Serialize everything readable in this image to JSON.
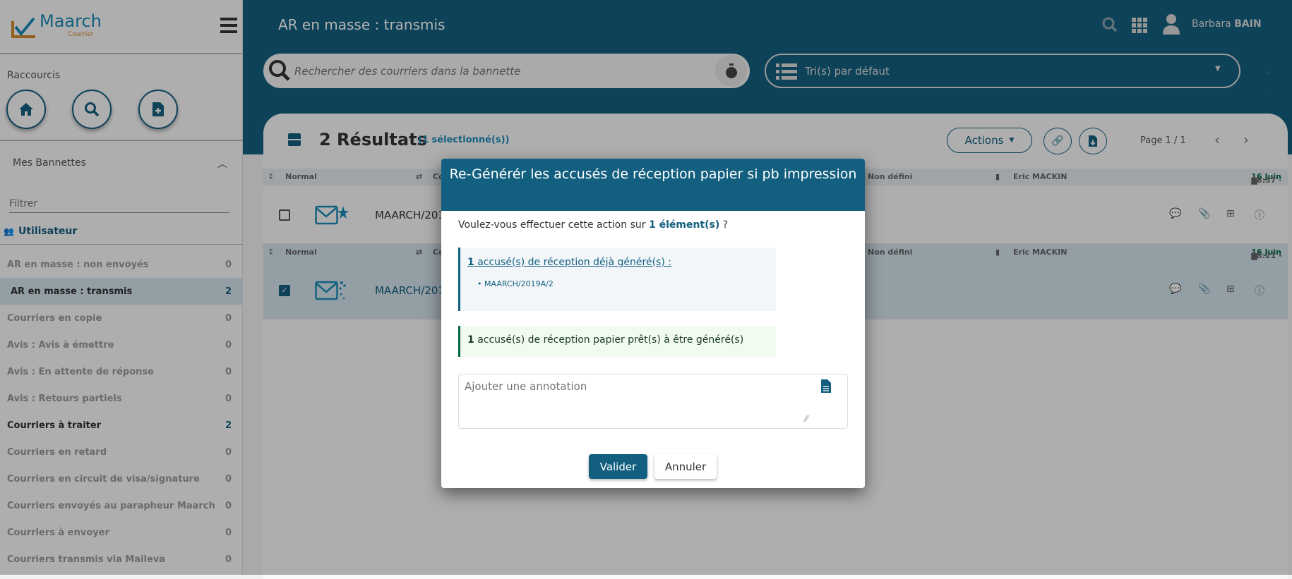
{
  "app": {
    "logo_text": "Maarch",
    "logo_sub": "Courrier",
    "page_title": "AR en masse : transmis"
  },
  "header": {
    "user_first": "Barbara",
    "user_last": "BAIN"
  },
  "search": {
    "placeholder": "Rechercher des courriers dans la bannette"
  },
  "sort": {
    "selected": "Tri(s) par défaut"
  },
  "sidebar": {
    "shortcuts_title": "Raccourcis",
    "bannettes_title": "Mes Bannettes",
    "filter_placeholder": "Filtrer",
    "group": "Utilisateur",
    "items": [
      {
        "label": "AR en masse : non envoyés",
        "count": "0"
      },
      {
        "label": "AR en masse : transmis",
        "count": "2"
      },
      {
        "label": "Courriers en copie",
        "count": "0"
      },
      {
        "label": "Avis : Avis à émettre",
        "count": "0"
      },
      {
        "label": "Avis : En attente de réponse",
        "count": "0"
      },
      {
        "label": "Avis : Retours partiels",
        "count": "0"
      },
      {
        "label": "Courriers à traiter",
        "count": "2"
      },
      {
        "label": "Courriers en retard",
        "count": "0"
      },
      {
        "label": "Courriers en circuit de visa/signature",
        "count": "0"
      },
      {
        "label": "Courriers envoyés au parapheur Maarch",
        "count": "0"
      },
      {
        "label": "Courriers à envoyer",
        "count": "0"
      },
      {
        "label": "Courriers transmis via Maileva",
        "count": "0"
      }
    ]
  },
  "results": {
    "count_label": "2 Résultats",
    "selected_label": "(1 sélectionné(s))",
    "actions_label": "Actions",
    "page_label": "Page 1 / 1"
  },
  "rows": [
    {
      "priority": "Normal",
      "category": "Co",
      "status": "Non défini",
      "owner": "Eric MACKIN",
      "time": "18:57 -",
      "date": "16 Juin",
      "ref": "MAARCH/201",
      "checked": false
    },
    {
      "priority": "Normal",
      "category": "Co",
      "status": "Non défini",
      "owner": "Eric MACKIN",
      "time": "18:21 -",
      "date": "16 Juin",
      "ref": "MAARCH/201",
      "checked": true
    }
  ],
  "modal": {
    "title": "Re-Générér les accusés de réception papier si pb impression",
    "question_pre": "Voulez-vous effectuer cette action sur ",
    "question_count": "1 élément(s)",
    "question_post": " ?",
    "already_count": "1",
    "already_text": " accusé(s) de réception déjà généré(s) :",
    "already_items": [
      "MAARCH/2019A/2"
    ],
    "ready_count": "1",
    "ready_text": " accusé(s) de réception papier prêt(s) à être généré(s)",
    "annotation_placeholder": "Ajouter une annotation",
    "validate": "Valider",
    "cancel": "Annuler"
  },
  "colors": {
    "primary": "#135f7f",
    "accent_orange": "#d48a2c",
    "success": "#006841"
  }
}
